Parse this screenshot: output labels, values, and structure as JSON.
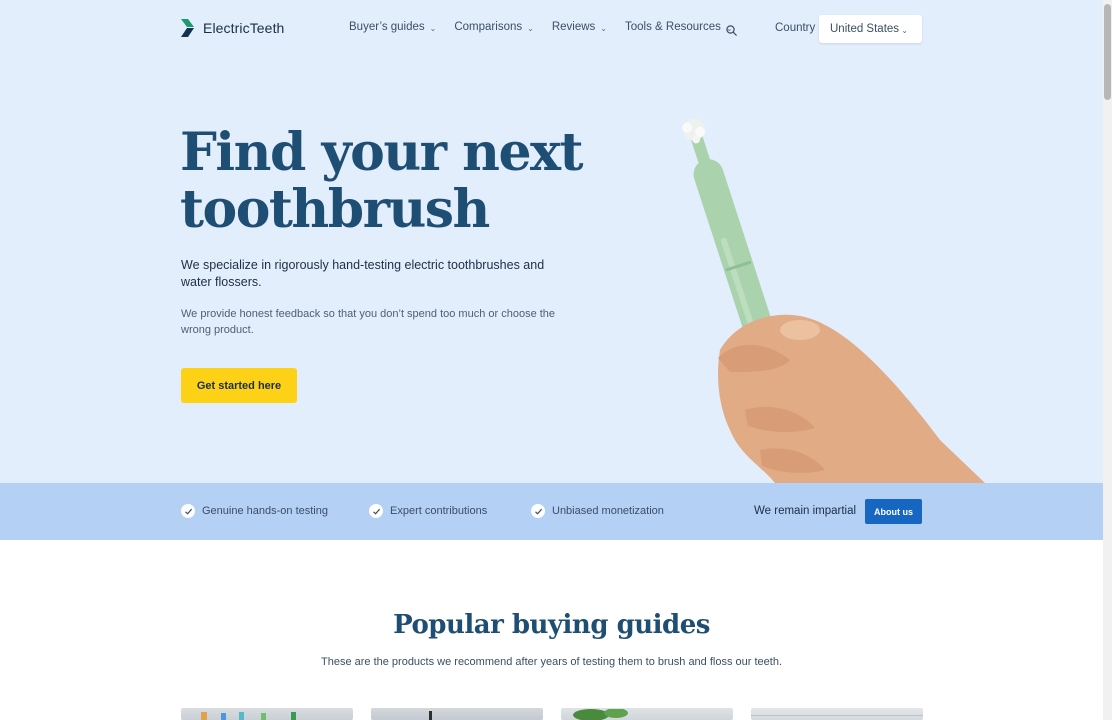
{
  "brand": {
    "name": "ElectricTeeth",
    "accent": "#1a9a6e"
  },
  "nav": {
    "items": [
      {
        "label": "Buyer’s guides"
      },
      {
        "label": "Comparisons"
      },
      {
        "label": "Reviews"
      },
      {
        "label": "Tools & Resources"
      }
    ],
    "search_icon": "search-icon",
    "country_label": "Country",
    "country_value": "United States"
  },
  "hero": {
    "headline_line1": "Find your next",
    "headline_line2": "toothbrush",
    "lede": "We specialize in rigorously hand-testing electric toothbrushes and water flossers.",
    "sub": "We provide honest feedback so that you don’t spend too much or choose the wrong product.",
    "cta_label": "Get started here",
    "background": "#e3eefc",
    "cta_color": "#fcd116"
  },
  "trust": {
    "items": [
      {
        "label": "Genuine hands-on testing"
      },
      {
        "label": "Expert contributions"
      },
      {
        "label": "Unbiased monetization"
      }
    ],
    "impartial_text": "We remain impartial",
    "about_label": "About us",
    "background": "#b4d0f4",
    "button_color": "#1766c2"
  },
  "guides": {
    "title": "Popular buying guides",
    "subtitle": "These are the products we recommend after years of testing them to brush and floss our teeth."
  }
}
